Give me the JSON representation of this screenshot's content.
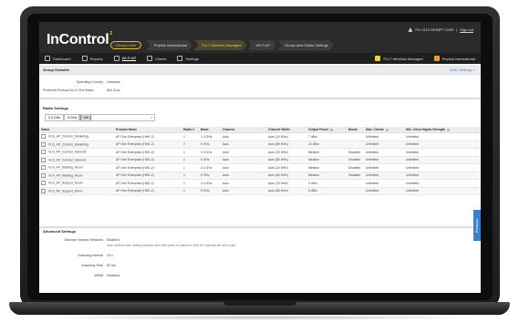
{
  "app": {
    "logo": "InControl",
    "logo_mark": "2"
  },
  "account": {
    "text": "Pro 1112-5E3BP7-0490",
    "signout": "Sign out"
  },
  "breadcrumbs": {
    "group": "Group Level",
    "items": [
      "Peplink International",
      "PLLT Wireless Managed",
      "Wi-Fi AP",
      "Group-wide Radio Settings"
    ]
  },
  "toolbar": {
    "items": [
      "Dashboard",
      "Reports",
      "Wi-Fi AP",
      "Clients",
      "Settings"
    ],
    "right_items": [
      "PLLT Wireless Managed",
      "Peplink International"
    ]
  },
  "group_defaults": {
    "title": "Group Defaults",
    "ssid_link": "SSID Settings »",
    "country_label": "Operating Country",
    "country_value": "Lithuania",
    "protocol_label": "Preferred Protocol for 5 GHz Radio",
    "protocol_value": "802.11ac"
  },
  "radio_settings": {
    "title": "Radio Settings",
    "filters": [
      "2.4 GHz",
      "5 GHz",
      "All"
    ],
    "search_placeholder": "Search",
    "columns": [
      "Name",
      "Product Name",
      "Radio #",
      "Band",
      "Channel",
      "Channel Width",
      "Output Power",
      "Boost",
      "Max. Clients",
      "Min. Client Signal Strength"
    ],
    "rows": [
      [
        "VLN_AP_Corridor_Marketing",
        "AP One Enterprise (HW1.2)",
        "1",
        "2.4 GHz",
        "Auto",
        "Auto (20 MHz)",
        "7 dBm",
        "",
        "Unlimited",
        "Unlimited"
      ],
      [
        "VLN_AP_Corridor_Marketing",
        "AP One Enterprise (HW1.2)",
        "2",
        "5 GHz",
        "Auto",
        "Auto (80 MHz)",
        "10 dBm",
        "",
        "Unlimited",
        "Unlimited"
      ],
      [
        "VLN_AP_Corridor_Network",
        "AP One Enterprise (HW1.2)",
        "1",
        "2.4 GHz",
        "Auto",
        "Auto (20 MHz)",
        "Medium",
        "Disabled",
        "Unlimited",
        "Unlimited"
      ],
      [
        "VLN_AP_Corridor_Network",
        "AP One Enterprise (HW1.2)",
        "2",
        "5 GHz",
        "Auto",
        "Auto (80 MHz)",
        "Medium",
        "Disabled",
        "Unlimited",
        "Unlimited"
      ],
      [
        "VLN_AP_Meeting_Room",
        "AP One Enterprise (HW1.2)",
        "1",
        "2.4 GHz",
        "Auto",
        "Auto (20 MHz)",
        "Medium",
        "Disabled",
        "Unlimited",
        "Unlimited"
      ],
      [
        "VLN_AP_Meeting_Room",
        "AP One Enterprise (HW1.2)",
        "2",
        "5 GHz",
        "Auto",
        "Auto (80 MHz)",
        "Medium",
        "Disabled",
        "Unlimited",
        "Unlimited"
      ],
      [
        "VLN_AP_Support_Room",
        "AP One Enterprise (HW1.2)",
        "1",
        "2.4 GHz",
        "Auto",
        "Auto (20 MHz)",
        "3 dBm",
        "",
        "Unlimited",
        "Unlimited"
      ],
      [
        "VLN_AP_Support_Room",
        "AP One Enterprise (HW1.2)",
        "2",
        "5 GHz",
        "Auto",
        "Auto (80 MHz)",
        "5 dBm",
        "",
        "Unlimited",
        "Unlimited"
      ]
    ]
  },
  "advanced": {
    "title": "Advanced Settings",
    "nearby_label": "Discover Nearby Networks",
    "nearby_value": "Disabled",
    "nearby_note": "Note: devices scan nearby networks when this option is enabled or their AP channels are set to auto.",
    "scan_interval_label": "Scanning Interval",
    "scan_interval_value": "10 s",
    "scan_time_label": "Scanning Time",
    "scan_time_value": "60 ms",
    "wmm_label": "WMM",
    "wmm_value": "Disabled"
  },
  "feedback": "Feedback",
  "colors": {
    "header": "#2b2b2b",
    "accent": "#f2c84b",
    "link": "#3b7fc4"
  }
}
